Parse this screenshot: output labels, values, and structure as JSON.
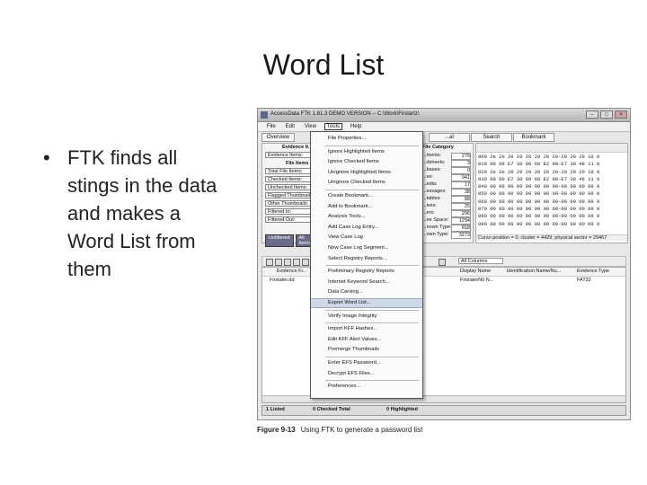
{
  "slide": {
    "title": "Word List",
    "bullet": "FTK finds all stings in the data and makes a Word List from them"
  },
  "window": {
    "title": "AccessData FTK 1.81.3 DEMO VERSION -- C:\\Work\\Firstartz\\",
    "menu": [
      "File",
      "Edit",
      "View",
      "Tools",
      "Help"
    ],
    "left_tab": "Overview",
    "right_tabs": [
      "...al",
      "Search",
      "Bookmark"
    ],
    "evidence_header": "Evidence It...",
    "file_items_header": "File Items",
    "left_items": [
      "Evidence Items:",
      "Total File Items:",
      "Checked Items:",
      "Unchecked Items:",
      "Flagged Thumbnails:",
      "Other Thumbnails:",
      "Filtered In:",
      "Filtered Out:"
    ],
    "filter_buttons": [
      "Unfiltered",
      "All Items",
      "Ac"
    ],
    "category_header": "File Category",
    "categories": [
      {
        "label": "...ments:",
        "value": "279"
      },
      {
        "label": "...dsheets:",
        "value": "3"
      },
      {
        "label": "...bases:",
        "value": "0"
      },
      {
        "label": "...es:",
        "value": "941"
      },
      {
        "label": "...edia:",
        "value": "17"
      },
      {
        "label": "...essages:",
        "value": "38"
      },
      {
        "label": "...tables:",
        "value": "88"
      },
      {
        "label": "...ives:",
        "value": "25"
      },
      {
        "label": "...ers:",
        "value": "296"
      },
      {
        "label": "...ee Space:",
        "value": "1294"
      },
      {
        "label": "...nown Type:",
        "value": "818"
      },
      {
        "label": "...own Type:",
        "value": "3273"
      }
    ],
    "hex_lines": [
      "000 2e 20 20 20 20 20 20 20-20 20 20 10 0",
      "010 00 00 E7 30 00 60 E2 98-E7 30 48 11 0",
      "020 2e 2e 20 20 20 20 20 20-20 20 20 10 0",
      "030 00 00 E7 30 00 60 E2 98-E7 30 46 11 0",
      "040 00 00 00 00 00 00 00 00-00 00 00 00 0",
      "050 00 00 00 00 00 00 00 00-00 00 00 00 0",
      "060 00 00 00 00 00 00 00 00-00 00 00 00 0",
      "070 00 00 00 00 00 00 00 00-00 00 00 00 0",
      "080 00 00 00 00 00 00 00 00-00 00 00 00 0",
      "090 00 00 00 00 00 00 00 00-00 00 00 00 0"
    ],
    "hex_status": "Curso position = 0; cluster = 4429; physical sector = 29467",
    "all_columns": "All Columns",
    "grid_columns": {
      "evidence": "Evidence Fi...",
      "display": "Display Name",
      "ident": "Identification Name/Nu...",
      "type": "Evidence Type"
    },
    "grid_row": {
      "evidence": "Firstater.dd",
      "display": "FirstaterN0 N...",
      "type": "FAT32"
    },
    "status": {
      "listed": "1 Listed",
      "checked": "0 Checked Total",
      "highlighted": "0 Highlighted"
    }
  },
  "tools_menu": [
    {
      "label": "File Properties...",
      "sep_after": true
    },
    {
      "label": "Ignore Highlighted Items"
    },
    {
      "label": "Ignore Checked Items"
    },
    {
      "label": "Unignore Highlighted Items"
    },
    {
      "label": "Unignore Checked Items",
      "sep_after": true
    },
    {
      "label": "Create Bookmark..."
    },
    {
      "label": "Add to Bookmark..."
    },
    {
      "label": "Analysis Tools..."
    },
    {
      "label": "Add Case Log Entry..."
    },
    {
      "label": "View Case Log"
    },
    {
      "label": "New Case Log Segment..."
    },
    {
      "label": "Select Registry Reports...",
      "sep_after": true
    },
    {
      "label": "Preliminary Registry Reports"
    },
    {
      "label": "Internet Keyword Search..."
    },
    {
      "label": "Data Carving..."
    },
    {
      "label": "Export Word List...",
      "highlight": true,
      "sep_after": true
    },
    {
      "label": "Verify Image Integrity",
      "sep_after": true
    },
    {
      "label": "Import KFF Hashes..."
    },
    {
      "label": "Edit KFF Alert Values..."
    },
    {
      "label": "Premerge Thumbnails",
      "sep_after": true
    },
    {
      "label": "Enter EFS Password..."
    },
    {
      "label": "Decrypt EFS Files...",
      "sep_after": true
    },
    {
      "label": "Preferences..."
    }
  ],
  "caption": {
    "figure": "Figure 9-13",
    "text": "Using FTK to generate a password list"
  }
}
